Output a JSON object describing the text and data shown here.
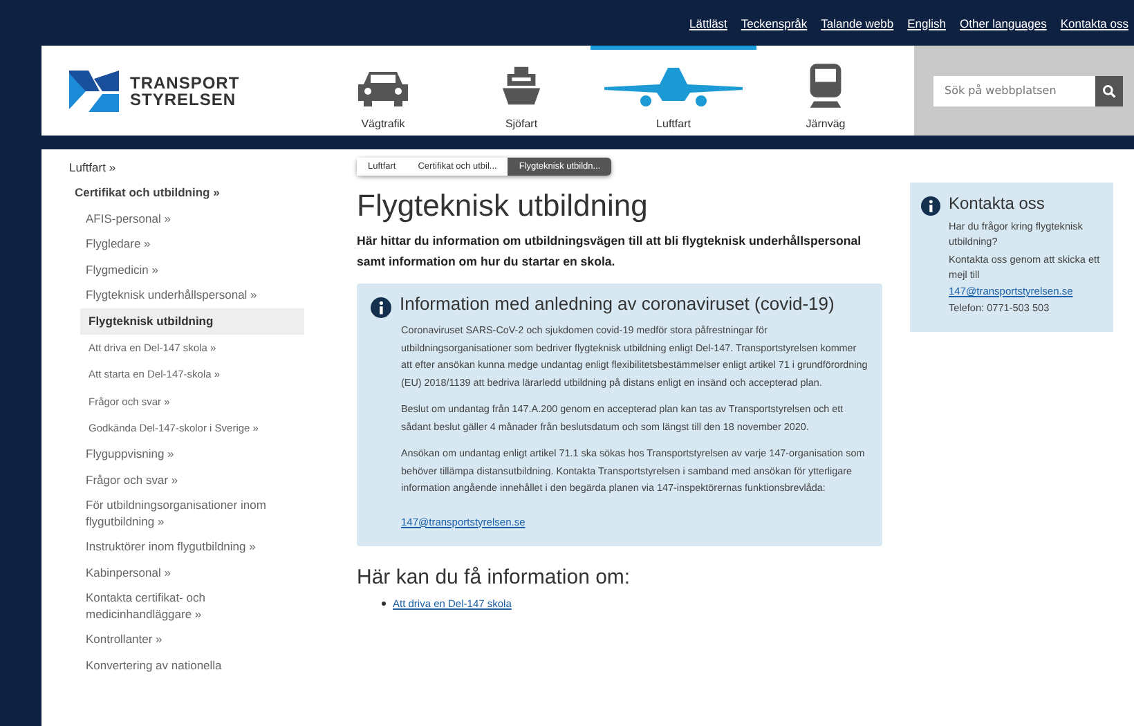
{
  "top_links": [
    "Lättläst",
    "Teckenspråk",
    "Talande webb",
    "English",
    "Other languages",
    "Kontakta oss"
  ],
  "logo": {
    "line1": "TRANSPORT",
    "line2": "STYRELSEN"
  },
  "nav": [
    {
      "label": "Vägtrafik",
      "kind": "car",
      "selected": false
    },
    {
      "label": "Sjöfart",
      "kind": "ship",
      "selected": false
    },
    {
      "label": "Luftfart",
      "kind": "plane",
      "selected": true
    },
    {
      "label": "Järnväg",
      "kind": "train",
      "selected": false
    }
  ],
  "search": {
    "placeholder": "Sök på webbplatsen"
  },
  "sidebar": {
    "items": [
      {
        "label": "Luftfart »",
        "selected": false,
        "children": [
          {
            "label": "Certifikat och utbildning »",
            "selected": false,
            "children": [
              {
                "label": "AFIS-personal »",
                "selected": false
              },
              {
                "label": "Flygledare  »",
                "selected": false
              },
              {
                "label": "Flygmedicin »",
                "selected": false
              },
              {
                "label": "Flygteknisk underhållspersonal »",
                "selected": false
              },
              {
                "label": "Flygteknisk utbildning",
                "selected": true,
                "children": [
                  {
                    "label": "Att driva en Del-147 skola »",
                    "selected": false
                  },
                  {
                    "label": "Att starta en Del-147-skola »",
                    "selected": false
                  },
                  {
                    "label": "Frågor och svar »",
                    "selected": false
                  },
                  {
                    "label": "Godkända Del-147-skolor i Sverige »",
                    "selected": false
                  }
                ]
              },
              {
                "label": "Flyguppvisning »",
                "selected": false
              },
              {
                "label": "Frågor och svar »",
                "selected": false
              },
              {
                "label": "För utbildningsorganisationer inom flygutbildning »",
                "selected": false
              },
              {
                "label": "Instruktörer inom flygutbildning »",
                "selected": false
              },
              {
                "label": "Kabinpersonal »",
                "selected": false
              },
              {
                "label": "Kontakta certifikat- och medicinhandläggare »",
                "selected": false
              },
              {
                "label": "Kontrollanter »",
                "selected": false
              },
              {
                "label": "Konvertering av nationella",
                "selected": false
              }
            ]
          }
        ]
      }
    ]
  },
  "breadcrumb": [
    {
      "label": "Luftfart",
      "selected": false
    },
    {
      "label": "Certifikat och utbil...",
      "selected": false
    },
    {
      "label": "Flygteknisk utbildn...",
      "selected": true
    }
  ],
  "title": "Flygteknisk utbildning",
  "intro": "Här hittar du information om utbildningsvägen till att bli flygteknisk underhållspersonal samt information om hur du startar en skola.",
  "notice": {
    "title": "Information med anledning av coronaviruset (covid-19)",
    "paragraphs": [
      "Coronaviruset SARS-CoV-2 och sjukdomen covid-19 medför stora påfrestningar för utbildningsorganisationer som bedriver flygteknisk utbildning enligt Del-147. Transportstyrelsen kommer att efter ansökan kunna medge undantag enligt flexibilitetsbestämmelser enligt artikel 71 i grundförordning (EU) 2018/1139 att bedriva lärarledd utbildning på distans enligt en insänd och accepterad plan.",
      "Beslut om undantag från 147.A.200 genom en accepterad plan kan tas av Transportstyrelsen och ett sådant beslut gäller 4 månader från beslutsdatum och som längst till den 18 november 2020.",
      "Ansökan om undantag enligt artikel 71.1 ska sökas hos Transportstyrelsen av varje 147-organisation som behöver tillämpa distansutbildning. Kontakta Transportstyrelsen i samband med ansökan för ytterligare information angående innehållet i den begärda planen via 147-inspektörernas funktionsbrevlåda:"
    ],
    "link": "147@transportstyrelsen.se"
  },
  "info_heading": "Här kan du få information om:",
  "info_links": [
    "Att driva en Del-147 skola"
  ],
  "contact": {
    "title": "Kontakta oss",
    "lines": [
      "Har du frågor kring flygteknisk utbildning?",
      "Kontakta oss genom att skicka ett mejl till"
    ],
    "link": "147@transportstyrelsen.se",
    "phone": "Telefon: 0771-503 503"
  }
}
